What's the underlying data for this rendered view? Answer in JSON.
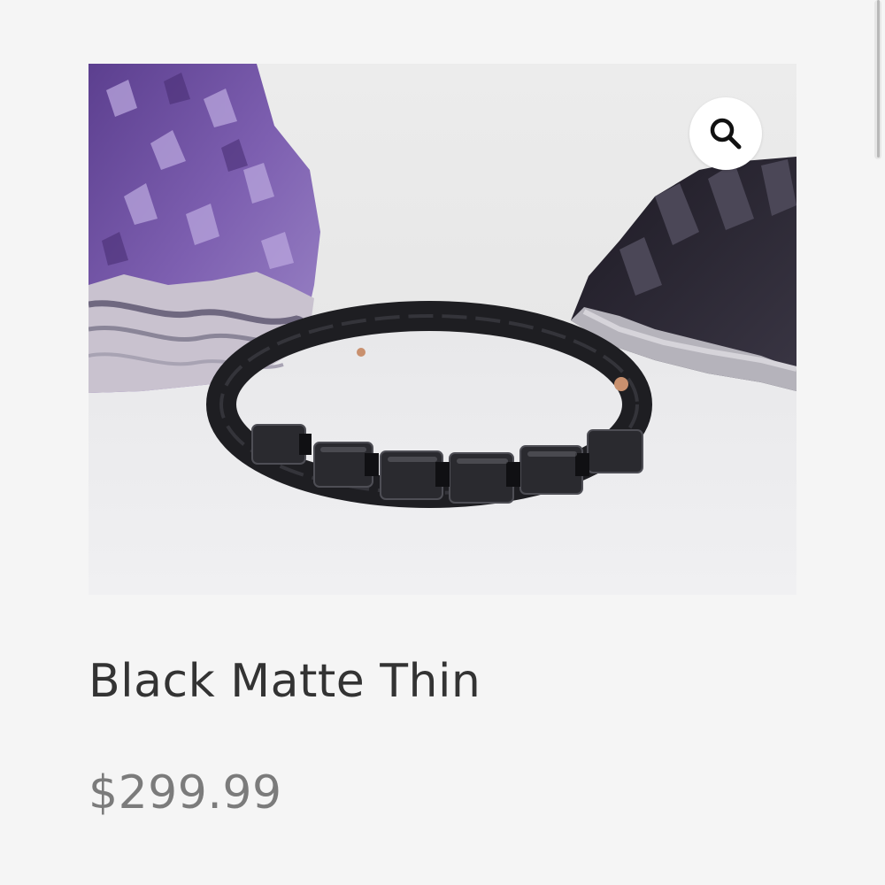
{
  "product": {
    "title": "Black Matte Thin",
    "price": "$299.99",
    "image_alt": "Black Matte Thin"
  },
  "controls": {
    "zoom_icon": "search-icon"
  },
  "colors": {
    "page_background": "#f5f5f5",
    "title_text": "#333333",
    "price_text": "#7b7b7b",
    "zoom_button": "#ffffff"
  }
}
